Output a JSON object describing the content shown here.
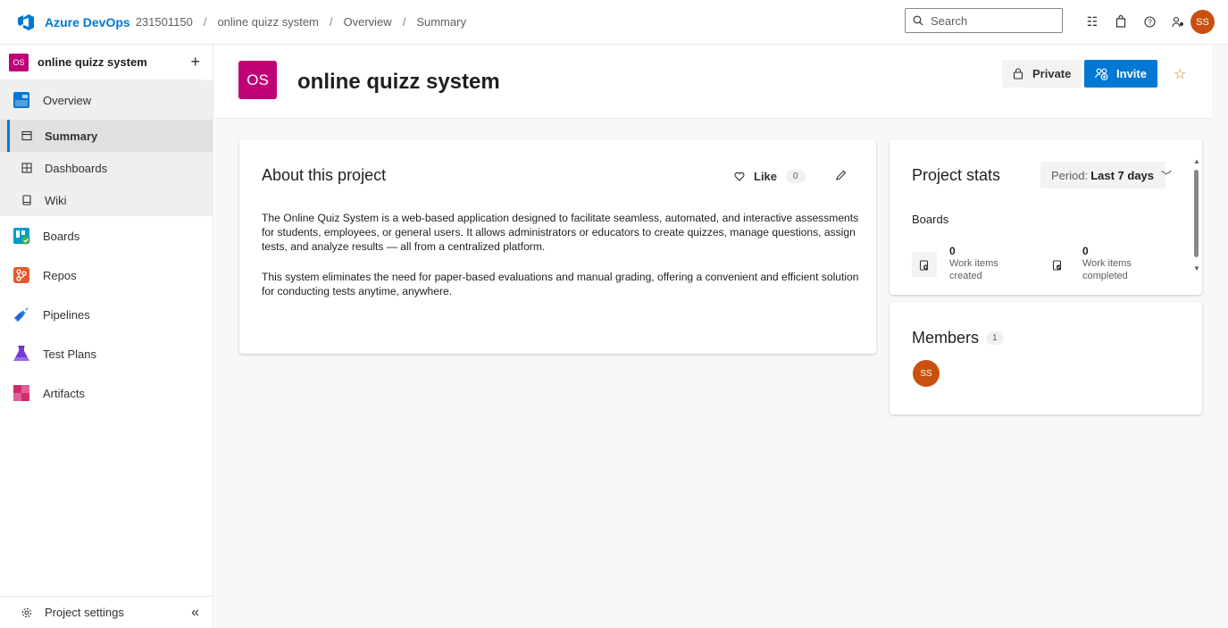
{
  "topbar": {
    "brand": "Azure DevOps",
    "org": "231501150",
    "separator": "/",
    "crumbs": [
      "online quizz system",
      "Overview",
      "Summary"
    ],
    "search_placeholder": "Search",
    "user_initials": "SS"
  },
  "sidebar": {
    "project_initials": "OS",
    "project_name": "online quizz system",
    "add_label": "+",
    "overview_label": "Overview",
    "sub_items": [
      "Summary",
      "Dashboards",
      "Wiki"
    ],
    "nav_items": [
      "Boards",
      "Repos",
      "Pipelines",
      "Test Plans",
      "Artifacts"
    ],
    "settings_label": "Project settings",
    "collapse_label": "«"
  },
  "header": {
    "tile_initials": "OS",
    "title": "online quizz system",
    "private_label": "Private",
    "invite_label": "Invite"
  },
  "about": {
    "title": "About this project",
    "like_label": "Like",
    "like_count": "0",
    "paragraph1": "The Online Quiz System is a web-based application designed to facilitate seamless, automated, and interactive assessments for students, employees, or general users. It allows administrators or educators to create quizzes, manage questions, assign tests, and analyze results — all from a centralized platform.",
    "paragraph2": "This system eliminates the need for paper-based evaluations and manual grading, offering a convenient and efficient solution for conducting tests anytime, anywhere."
  },
  "stats": {
    "title": "Project stats",
    "period_prefix": "Period:",
    "period_value": "Last 7 days",
    "section": "Boards",
    "created_value": "0",
    "created_label": "Work items created",
    "completed_value": "0",
    "completed_label": "Work items completed"
  },
  "members": {
    "title": "Members",
    "count": "1",
    "avatar_initials": "SS"
  },
  "colors": {
    "accent": "#0078d4",
    "project": "#bf0077",
    "avatar": "#ca5010"
  }
}
